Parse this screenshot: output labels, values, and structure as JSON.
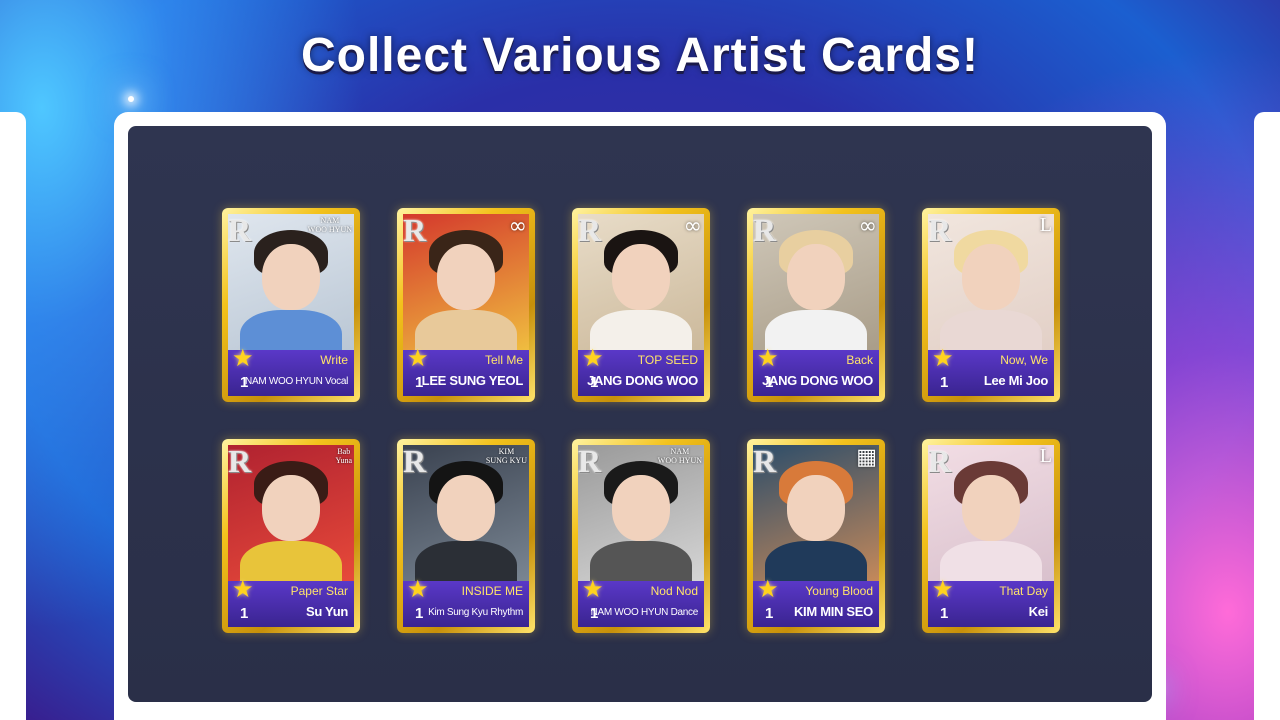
{
  "headline": "Collect Various Artist Cards!",
  "colors": {
    "gold": "#f3c21c",
    "info_bar": "#4a2eb0",
    "board": "#2d3350",
    "song_text": "#ffe46a"
  },
  "cards": [
    {
      "rank": "R",
      "badge_icon": "",
      "badge_text": "NAM\nWOO HYUN",
      "song": "Write",
      "artist": "NAM WOO HYUN Vocal",
      "level": "1",
      "small": true
    },
    {
      "rank": "R",
      "badge_icon": "infinity-icon",
      "badge_symbol": "∞",
      "song": "Tell Me",
      "artist": "LEE SUNG YEOL",
      "level": "1"
    },
    {
      "rank": "R",
      "badge_icon": "infinity-icon",
      "badge_symbol": "∞",
      "song": "TOP SEED",
      "artist": "JANG DONG WOO",
      "level": "1"
    },
    {
      "rank": "R",
      "badge_icon": "infinity-icon",
      "badge_symbol": "∞",
      "song": "Back",
      "artist": "JANG DONG WOO",
      "level": "1"
    },
    {
      "rank": "R",
      "badge_icon": "lovelyz-l-icon",
      "badge_symbol": "L",
      "song": "Now, We",
      "artist": "Lee Mi Joo",
      "level": "1"
    },
    {
      "rank": "R",
      "badge_icon": "",
      "badge_text": "Bab\nYuna",
      "song": "Paper Star",
      "artist": "Su Yun",
      "level": "1"
    },
    {
      "rank": "R",
      "badge_icon": "",
      "badge_text": "KIM\nSUNG KYU",
      "song": "INSIDE ME",
      "artist": "Kim Sung Kyu Rhythm",
      "level": "1",
      "small": true
    },
    {
      "rank": "R",
      "badge_icon": "",
      "badge_text": "NAM\nWOO HYUN",
      "song": "Nod Nod",
      "artist": "NAM WOO HYUN Dance",
      "level": "1",
      "small": true
    },
    {
      "rank": "R",
      "badge_icon": "grid-icon",
      "badge_symbol": "▦",
      "song": "Young Blood",
      "artist": "KIM MIN SEO",
      "level": "1"
    },
    {
      "rank": "R",
      "badge_icon": "lovelyz-l-icon",
      "badge_symbol": "L",
      "song": "That Day",
      "artist": "Kei",
      "level": "1"
    }
  ]
}
